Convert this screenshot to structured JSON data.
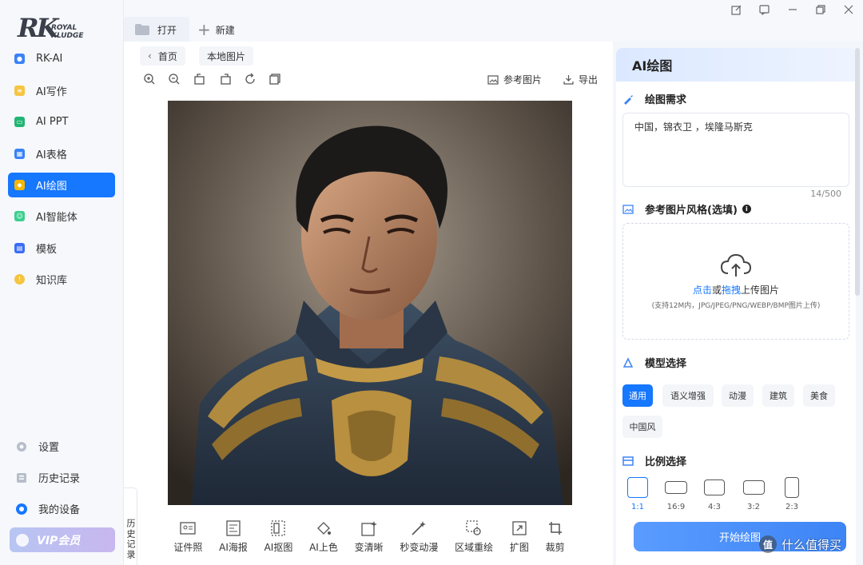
{
  "sidebar": {
    "logo_rk": "RK",
    "logo_royal": "ROYAL",
    "logo_kludge": "KLUDGE",
    "items": [
      {
        "label": "RK-AI",
        "color": "#3b82f6"
      },
      {
        "label": "AI写作",
        "color": "#f5c542"
      },
      {
        "label": "AI PPT",
        "color": "#22b573"
      },
      {
        "label": "AI表格",
        "color": "#3b82f6"
      },
      {
        "label": "AI绘图",
        "color": "#f5b800"
      },
      {
        "label": "AI智能体",
        "color": "#3ccf8e"
      },
      {
        "label": "模板",
        "color": "#3b6df5"
      },
      {
        "label": "知识库",
        "color": "#f5c542"
      }
    ],
    "active_index": 4,
    "bottom": {
      "settings": "设置",
      "history": "历史记录",
      "devices": "我的设备"
    },
    "vip_label": "VIP会员"
  },
  "tabs": {
    "open": "打开",
    "new": "新建"
  },
  "editor": {
    "breadcrumb_home": "首页",
    "breadcrumb_current": "本地图片",
    "reference_image": "参考图片",
    "export": "导出",
    "history_tab": "历史记录",
    "bottom_tools": [
      "证件照",
      "AI海报",
      "AI抠图",
      "AI上色",
      "变清晰",
      "秒变动漫",
      "区域重绘",
      "扩图",
      "裁剪"
    ]
  },
  "panel": {
    "title": "AI绘图",
    "prompt_section": "绘图需求",
    "prompt_value": "中国，锦衣卫 ，埃隆马斯克",
    "prompt_counter": "14/500",
    "style_section": "参考图片风格(选填)",
    "upload_click": "点击",
    "upload_or": "或",
    "upload_drag": "拖拽",
    "upload_suffix": "上传图片",
    "upload_hint": "(支持12M内，JPG/JPEG/PNG/WEBP/BMP图片上传)",
    "model_section": "模型选择",
    "models": [
      "通用",
      "语义增强",
      "动漫",
      "建筑",
      "美食",
      "中国风"
    ],
    "selected_model": "通用",
    "ratio_section": "比例选择",
    "ratios": [
      "1:1",
      "16:9",
      "4:3",
      "3:2",
      "2:3"
    ],
    "selected_ratio": "1:1",
    "start_button": "开始绘图"
  },
  "watermark": "什么值得买"
}
